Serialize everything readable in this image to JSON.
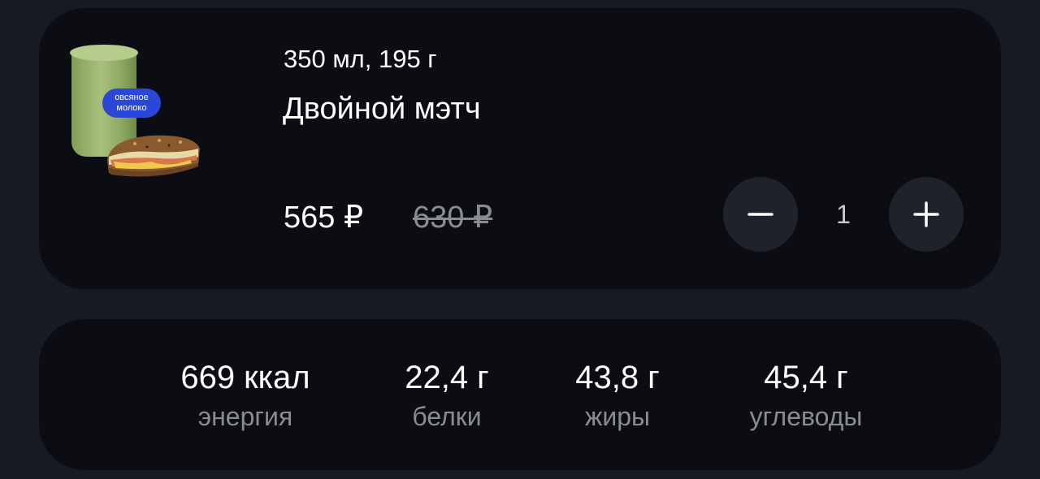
{
  "product": {
    "badge_line1": "овсяное",
    "badge_line2": "молоко",
    "weight": "350 мл, 195 г",
    "title": "Двойной мэтч",
    "price": "565 ₽",
    "old_price": "630 ₽",
    "quantity": "1"
  },
  "nutrition": [
    {
      "value": "669 ккал",
      "label": "энергия"
    },
    {
      "value": "22,4 г",
      "label": "белки"
    },
    {
      "value": "43,8 г",
      "label": "жиры"
    },
    {
      "value": "45,4 г",
      "label": "углеводы"
    }
  ],
  "colors": {
    "background": "#171a24",
    "card": "#0c0d12",
    "button": "#1f222b",
    "badge": "#2a47d8",
    "muted_text": "#8a8c93"
  },
  "icons": [
    "minus-icon",
    "plus-icon"
  ]
}
